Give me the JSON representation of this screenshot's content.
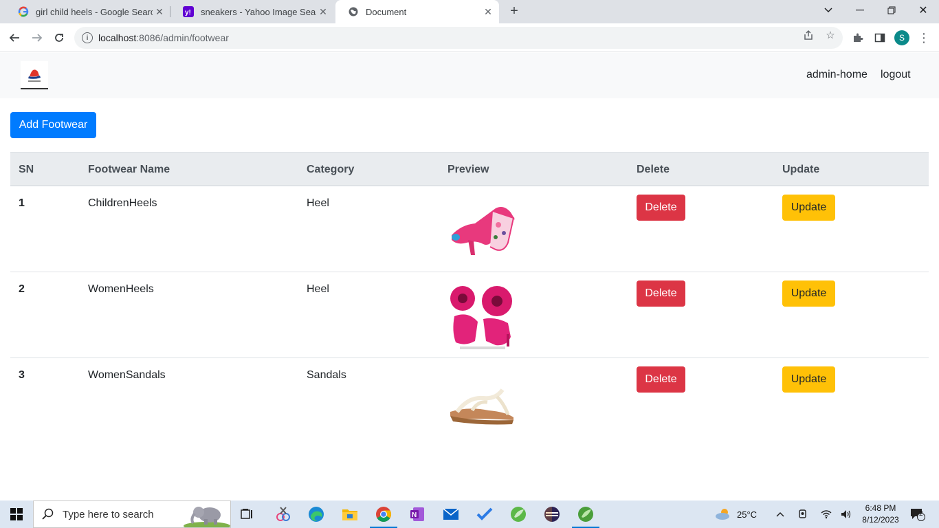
{
  "browser": {
    "tabs": [
      {
        "title": "girl child heels - Google Search",
        "favicon": "google-icon",
        "active": false
      },
      {
        "title": "sneakers - Yahoo Image Search R",
        "favicon": "yahoo-icon",
        "active": false
      },
      {
        "title": "Document",
        "favicon": "globe-icon",
        "active": true
      }
    ],
    "url_host": "localhost",
    "url_path": ":8086/admin/footwear",
    "profile_initial": "S"
  },
  "navbar": {
    "links": [
      "admin-home",
      "logout"
    ]
  },
  "main": {
    "add_button": "Add Footwear",
    "columns": [
      "SN",
      "Footwear Name",
      "Category",
      "Preview",
      "Delete",
      "Update"
    ],
    "rows": [
      {
        "sn": "1",
        "name": "ChildrenHeels",
        "category": "Heel",
        "delete": "Delete",
        "update": "Update"
      },
      {
        "sn": "2",
        "name": "WomenHeels",
        "category": "Heel",
        "delete": "Delete",
        "update": "Update"
      },
      {
        "sn": "3",
        "name": "WomenSandals",
        "category": "Sandals",
        "delete": "Delete",
        "update": "Update"
      }
    ]
  },
  "taskbar": {
    "search_placeholder": "Type here to search",
    "weather": "25°C",
    "time": "6:48 PM",
    "date": "8/12/2023",
    "notifications": "2"
  },
  "colors": {
    "primary": "#007bff",
    "danger": "#dc3545",
    "warning": "#ffc107"
  }
}
